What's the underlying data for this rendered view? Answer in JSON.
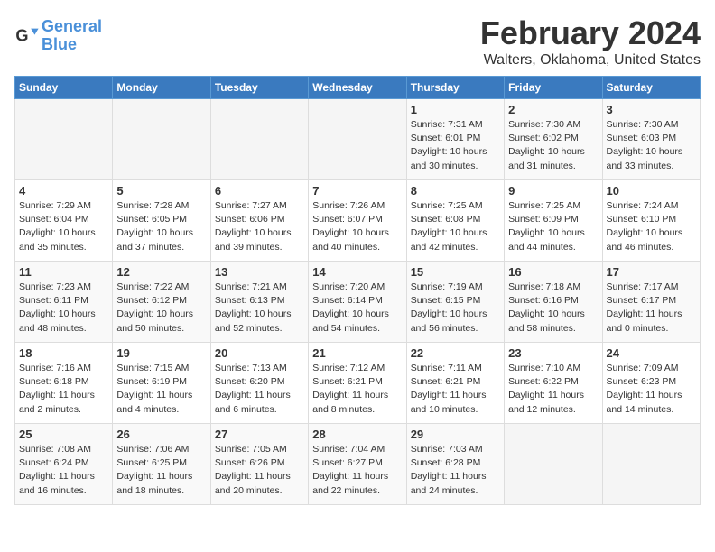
{
  "logo": {
    "line1": "General",
    "line2": "Blue"
  },
  "title": "February 2024",
  "subtitle": "Walters, Oklahoma, United States",
  "days_of_week": [
    "Sunday",
    "Monday",
    "Tuesday",
    "Wednesday",
    "Thursday",
    "Friday",
    "Saturday"
  ],
  "weeks": [
    [
      {
        "day": "",
        "info": ""
      },
      {
        "day": "",
        "info": ""
      },
      {
        "day": "",
        "info": ""
      },
      {
        "day": "",
        "info": ""
      },
      {
        "day": "1",
        "info": "Sunrise: 7:31 AM\nSunset: 6:01 PM\nDaylight: 10 hours\nand 30 minutes."
      },
      {
        "day": "2",
        "info": "Sunrise: 7:30 AM\nSunset: 6:02 PM\nDaylight: 10 hours\nand 31 minutes."
      },
      {
        "day": "3",
        "info": "Sunrise: 7:30 AM\nSunset: 6:03 PM\nDaylight: 10 hours\nand 33 minutes."
      }
    ],
    [
      {
        "day": "4",
        "info": "Sunrise: 7:29 AM\nSunset: 6:04 PM\nDaylight: 10 hours\nand 35 minutes."
      },
      {
        "day": "5",
        "info": "Sunrise: 7:28 AM\nSunset: 6:05 PM\nDaylight: 10 hours\nand 37 minutes."
      },
      {
        "day": "6",
        "info": "Sunrise: 7:27 AM\nSunset: 6:06 PM\nDaylight: 10 hours\nand 39 minutes."
      },
      {
        "day": "7",
        "info": "Sunrise: 7:26 AM\nSunset: 6:07 PM\nDaylight: 10 hours\nand 40 minutes."
      },
      {
        "day": "8",
        "info": "Sunrise: 7:25 AM\nSunset: 6:08 PM\nDaylight: 10 hours\nand 42 minutes."
      },
      {
        "day": "9",
        "info": "Sunrise: 7:25 AM\nSunset: 6:09 PM\nDaylight: 10 hours\nand 44 minutes."
      },
      {
        "day": "10",
        "info": "Sunrise: 7:24 AM\nSunset: 6:10 PM\nDaylight: 10 hours\nand 46 minutes."
      }
    ],
    [
      {
        "day": "11",
        "info": "Sunrise: 7:23 AM\nSunset: 6:11 PM\nDaylight: 10 hours\nand 48 minutes."
      },
      {
        "day": "12",
        "info": "Sunrise: 7:22 AM\nSunset: 6:12 PM\nDaylight: 10 hours\nand 50 minutes."
      },
      {
        "day": "13",
        "info": "Sunrise: 7:21 AM\nSunset: 6:13 PM\nDaylight: 10 hours\nand 52 minutes."
      },
      {
        "day": "14",
        "info": "Sunrise: 7:20 AM\nSunset: 6:14 PM\nDaylight: 10 hours\nand 54 minutes."
      },
      {
        "day": "15",
        "info": "Sunrise: 7:19 AM\nSunset: 6:15 PM\nDaylight: 10 hours\nand 56 minutes."
      },
      {
        "day": "16",
        "info": "Sunrise: 7:18 AM\nSunset: 6:16 PM\nDaylight: 10 hours\nand 58 minutes."
      },
      {
        "day": "17",
        "info": "Sunrise: 7:17 AM\nSunset: 6:17 PM\nDaylight: 11 hours\nand 0 minutes."
      }
    ],
    [
      {
        "day": "18",
        "info": "Sunrise: 7:16 AM\nSunset: 6:18 PM\nDaylight: 11 hours\nand 2 minutes."
      },
      {
        "day": "19",
        "info": "Sunrise: 7:15 AM\nSunset: 6:19 PM\nDaylight: 11 hours\nand 4 minutes."
      },
      {
        "day": "20",
        "info": "Sunrise: 7:13 AM\nSunset: 6:20 PM\nDaylight: 11 hours\nand 6 minutes."
      },
      {
        "day": "21",
        "info": "Sunrise: 7:12 AM\nSunset: 6:21 PM\nDaylight: 11 hours\nand 8 minutes."
      },
      {
        "day": "22",
        "info": "Sunrise: 7:11 AM\nSunset: 6:21 PM\nDaylight: 11 hours\nand 10 minutes."
      },
      {
        "day": "23",
        "info": "Sunrise: 7:10 AM\nSunset: 6:22 PM\nDaylight: 11 hours\nand 12 minutes."
      },
      {
        "day": "24",
        "info": "Sunrise: 7:09 AM\nSunset: 6:23 PM\nDaylight: 11 hours\nand 14 minutes."
      }
    ],
    [
      {
        "day": "25",
        "info": "Sunrise: 7:08 AM\nSunset: 6:24 PM\nDaylight: 11 hours\nand 16 minutes."
      },
      {
        "day": "26",
        "info": "Sunrise: 7:06 AM\nSunset: 6:25 PM\nDaylight: 11 hours\nand 18 minutes."
      },
      {
        "day": "27",
        "info": "Sunrise: 7:05 AM\nSunset: 6:26 PM\nDaylight: 11 hours\nand 20 minutes."
      },
      {
        "day": "28",
        "info": "Sunrise: 7:04 AM\nSunset: 6:27 PM\nDaylight: 11 hours\nand 22 minutes."
      },
      {
        "day": "29",
        "info": "Sunrise: 7:03 AM\nSunset: 6:28 PM\nDaylight: 11 hours\nand 24 minutes."
      },
      {
        "day": "",
        "info": ""
      },
      {
        "day": "",
        "info": ""
      }
    ]
  ]
}
